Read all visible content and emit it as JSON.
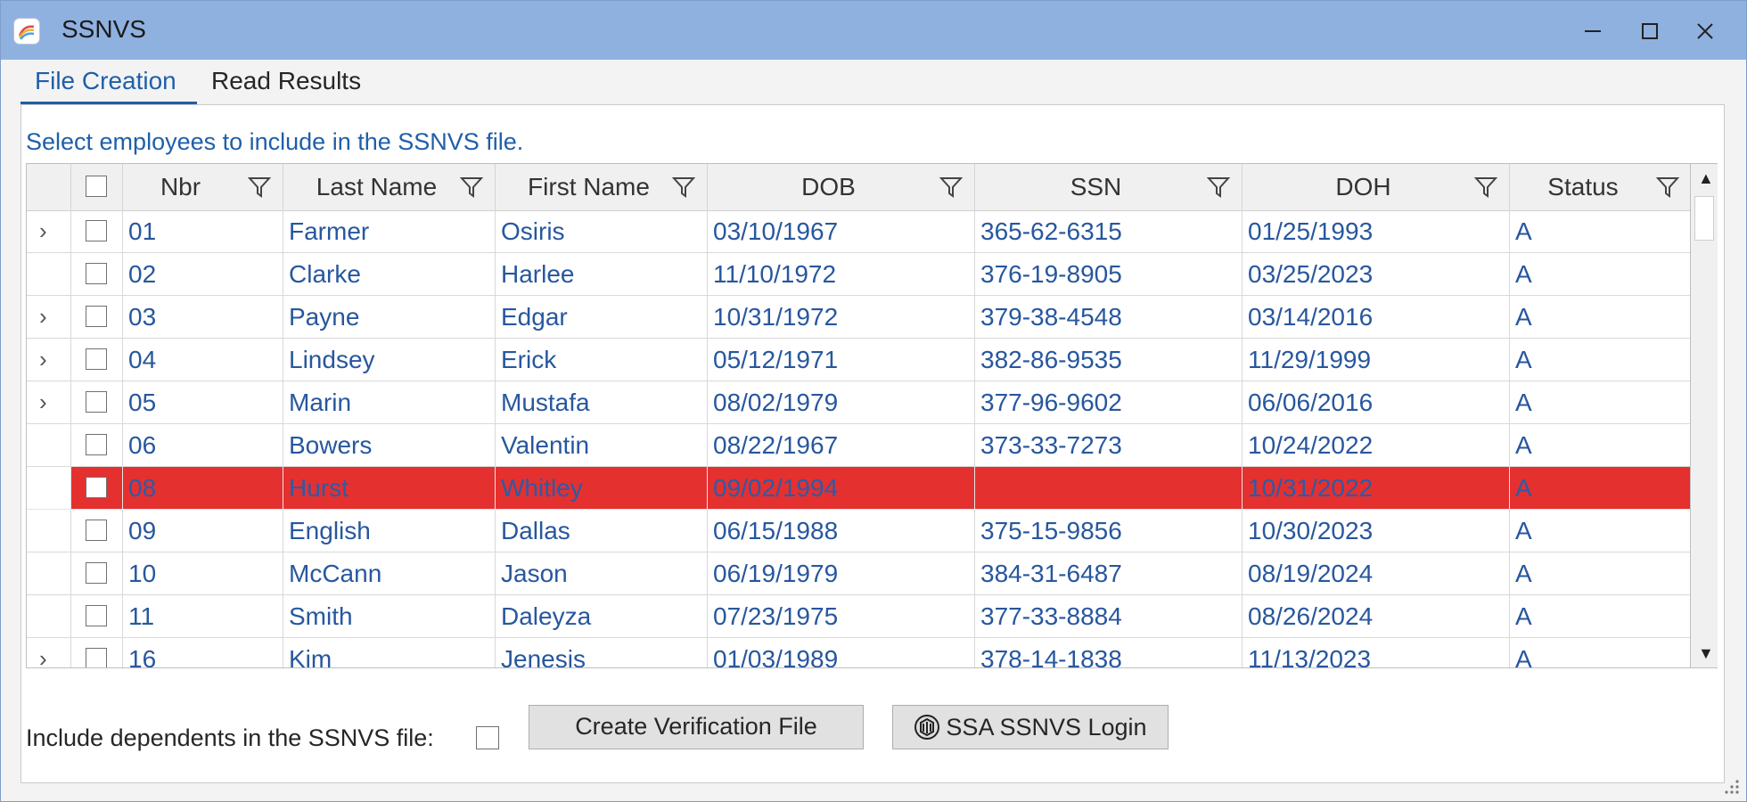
{
  "window": {
    "title": "SSNVS"
  },
  "tabs": [
    {
      "label": "File Creation",
      "active": true
    },
    {
      "label": "Read Results",
      "active": false
    }
  ],
  "instruction": "Select employees to include in the SSNVS file.",
  "grid": {
    "columns": [
      "Nbr",
      "Last Name",
      "First Name",
      "DOB",
      "SSN",
      "DOH",
      "Status"
    ],
    "rows": [
      {
        "expandable": true,
        "nbr": "01",
        "last": "Farmer",
        "first": "Osiris",
        "dob": "03/10/1967",
        "ssn": "365-62-6315",
        "doh": "01/25/1993",
        "status": "A",
        "error": false
      },
      {
        "expandable": false,
        "nbr": "02",
        "last": "Clarke",
        "first": "Harlee",
        "dob": "11/10/1972",
        "ssn": "376-19-8905",
        "doh": "03/25/2023",
        "status": "A",
        "error": false
      },
      {
        "expandable": true,
        "nbr": "03",
        "last": "Payne",
        "first": "Edgar",
        "dob": "10/31/1972",
        "ssn": "379-38-4548",
        "doh": "03/14/2016",
        "status": "A",
        "error": false
      },
      {
        "expandable": true,
        "nbr": "04",
        "last": "Lindsey",
        "first": "Erick",
        "dob": "05/12/1971",
        "ssn": "382-86-9535",
        "doh": "11/29/1999",
        "status": "A",
        "error": false
      },
      {
        "expandable": true,
        "nbr": "05",
        "last": "Marin",
        "first": "Mustafa",
        "dob": "08/02/1979",
        "ssn": "377-96-9602",
        "doh": "06/06/2016",
        "status": "A",
        "error": false
      },
      {
        "expandable": false,
        "nbr": "06",
        "last": "Bowers",
        "first": "Valentin",
        "dob": "08/22/1967",
        "ssn": "373-33-7273",
        "doh": "10/24/2022",
        "status": "A",
        "error": false
      },
      {
        "expandable": false,
        "nbr": "08",
        "last": "Hurst",
        "first": "Whitley",
        "dob": "09/02/1994",
        "ssn": "",
        "doh": "10/31/2022",
        "status": "A",
        "error": true
      },
      {
        "expandable": false,
        "nbr": "09",
        "last": "English",
        "first": "Dallas",
        "dob": "06/15/1988",
        "ssn": "375-15-9856",
        "doh": "10/30/2023",
        "status": "A",
        "error": false
      },
      {
        "expandable": false,
        "nbr": "10",
        "last": "McCann",
        "first": "Jason",
        "dob": "06/19/1979",
        "ssn": "384-31-6487",
        "doh": "08/19/2024",
        "status": "A",
        "error": false
      },
      {
        "expandable": false,
        "nbr": "11",
        "last": "Smith",
        "first": "Daleyza",
        "dob": "07/23/1975",
        "ssn": "377-33-8884",
        "doh": "08/26/2024",
        "status": "A",
        "error": false
      },
      {
        "expandable": true,
        "nbr": "16",
        "last": "Kim",
        "first": "Jenesis",
        "dob": "01/03/1989",
        "ssn": "378-14-1838",
        "doh": "11/13/2023",
        "status": "A",
        "error": false
      }
    ]
  },
  "footer": {
    "include_dependents_label": "Include dependents in the SSNVS file:",
    "create_button": "Create Verification File",
    "login_button": "SSA SSNVS Login"
  },
  "colors": {
    "titlebar": "#8fb1e0",
    "accent": "#1f5fa8",
    "error_row": "#e53030"
  }
}
